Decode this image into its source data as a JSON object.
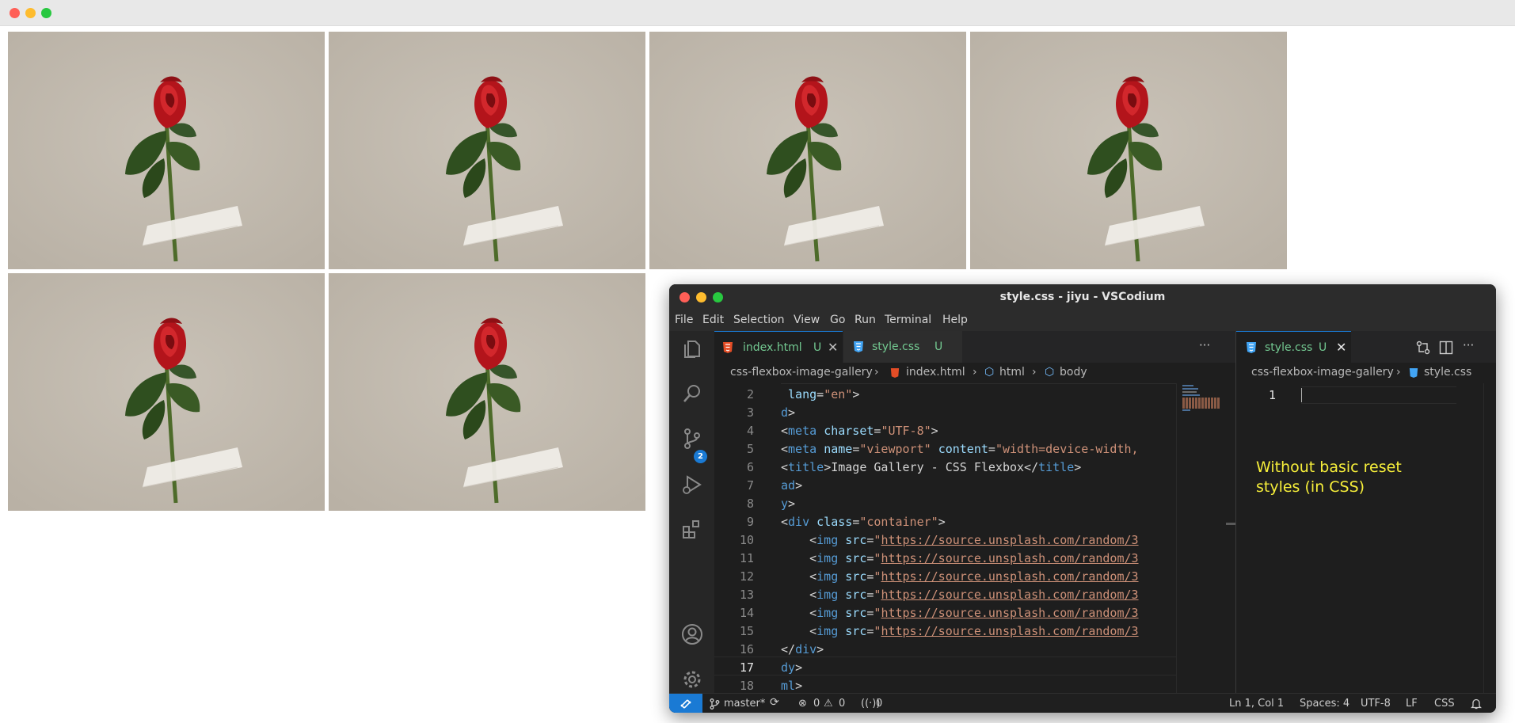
{
  "vscodium": {
    "window_title": "style.css - jiyu - VSCodium",
    "menu": [
      "File",
      "Edit",
      "Selection",
      "View",
      "Go",
      "Run",
      "Terminal",
      "Help"
    ],
    "scm_badge": "2",
    "tabs": [
      {
        "label": "index.html",
        "status": "U",
        "active": true
      },
      {
        "label": "style.css",
        "status": "U",
        "active": false
      }
    ],
    "more_actions": "···",
    "breadcrumb_left": [
      "css-flexbox-image-gallery",
      "index.html",
      "html",
      "body"
    ],
    "code_lines": [
      {
        "n": "2",
        "text": "  lang=\"en\">"
      },
      {
        "n": "3",
        "text": "d>"
      },
      {
        "n": "4",
        "text": "<meta charset=\"UTF-8\">"
      },
      {
        "n": "5",
        "text": "<meta name=\"viewport\" content=\"width=device-width,"
      },
      {
        "n": "6",
        "text": "<title>Image Gallery - CSS Flexbox</title>"
      },
      {
        "n": "7",
        "text": "ad>"
      },
      {
        "n": "8",
        "text": "y>"
      },
      {
        "n": "9",
        "text": "<div class=\"container\">"
      },
      {
        "n": "10",
        "text": "    <img src=\"https://source.unsplash.com/random/3"
      },
      {
        "n": "11",
        "text": "    <img src=\"https://source.unsplash.com/random/3"
      },
      {
        "n": "12",
        "text": "    <img src=\"https://source.unsplash.com/random/3"
      },
      {
        "n": "13",
        "text": "    <img src=\"https://source.unsplash.com/random/3"
      },
      {
        "n": "14",
        "text": "    <img src=\"https://source.unsplash.com/random/3"
      },
      {
        "n": "15",
        "text": "    <img src=\"https://source.unsplash.com/random/3"
      },
      {
        "n": "16",
        "text": "</div>"
      },
      {
        "n": "17",
        "text": "dy>"
      },
      {
        "n": "18",
        "text": "ml>"
      }
    ],
    "right_tab": {
      "label": "style.css",
      "status": "U"
    },
    "breadcrumb_right": [
      "css-flexbox-image-gallery",
      "style.css"
    ],
    "right_line_number": "1",
    "status": {
      "branch": "master*",
      "errors": "0",
      "warnings": "0",
      "ports": "0",
      "position": "Ln 1, Col 1",
      "spaces": "Spaces: 4",
      "encoding": "UTF-8",
      "eol": "LF",
      "language": "CSS"
    }
  },
  "annotation": "Without basic reset styles (in CSS)",
  "colors": {
    "accent_blue": "#1a7ad4",
    "annotation_yellow": "#f7ef3a",
    "html_icon": "#e44d26",
    "css_icon": "#42a5f5",
    "untracked_green": "#73c991"
  }
}
